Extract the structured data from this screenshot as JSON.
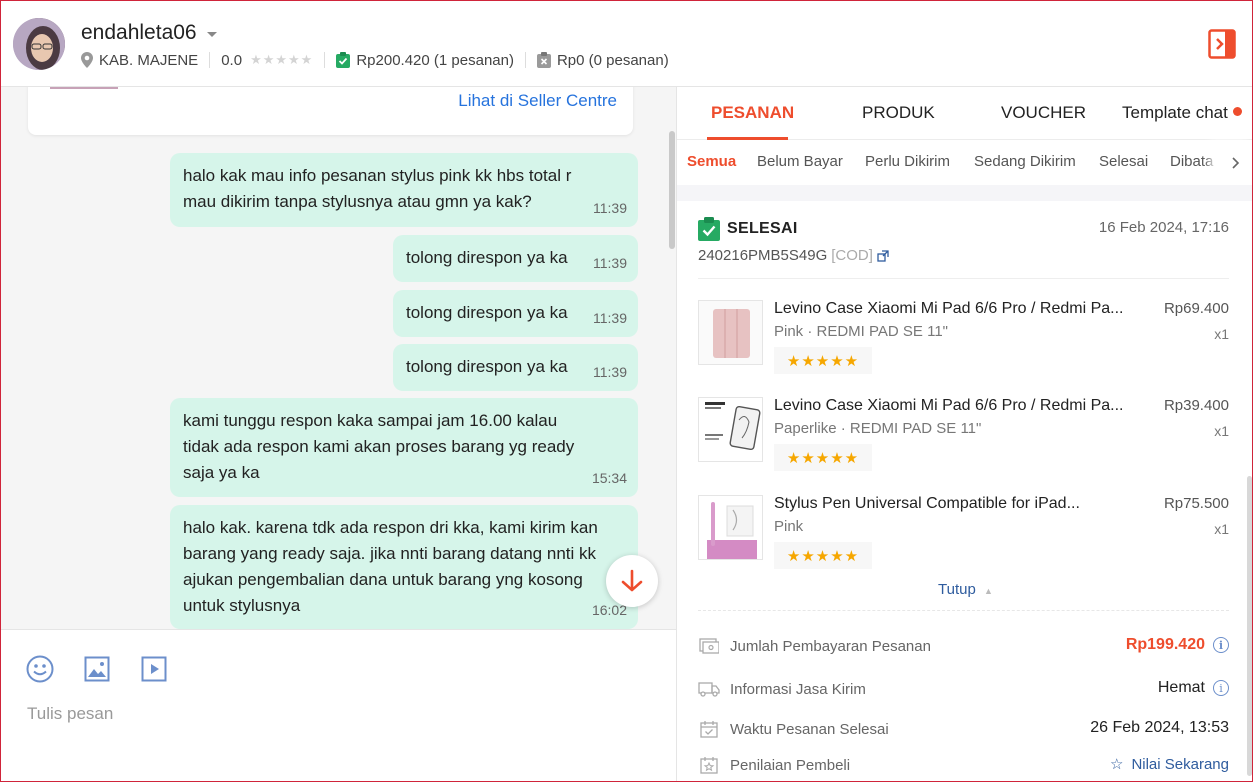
{
  "header": {
    "username": "endahleta06",
    "location": "KAB. MAJENE",
    "rating": "0.0",
    "orders_paid": "Rp200.420 (1 pesanan)",
    "orders_cancelled": "Rp0 (0 pesanan)"
  },
  "chat": {
    "seller_link": "Lihat di Seller Centre",
    "messages": [
      {
        "line1": "halo kak mau info pesanan  stylus pink kk hbs total r",
        "line2": "mau dikirim  tanpa stylusnya  atau gmn ya kak?",
        "time": "11:39"
      },
      {
        "line1": "tolong direspon ya ka",
        "time": "11:39"
      },
      {
        "line1": "tolong direspon ya ka",
        "time": "11:39"
      },
      {
        "line1": "tolong direspon ya ka",
        "time": "11:39"
      },
      {
        "line1": "kami tunggu respon kaka sampai jam  16.00 kalau",
        "line2": "tidak ada respon kami akan proses barang yg ready",
        "line3": "saja ya ka",
        "time": "15:34"
      },
      {
        "line1": "halo kak. karena tdk ada respon dri kka, kami kirim kan",
        "line2": "barang yang ready saja. jika nnti barang datang nnti kk",
        "line3": "ajukan pengembalian dana untuk barang yng kosong",
        "line4": "untuk stylusnya",
        "time": "16:02"
      }
    ],
    "composer_placeholder": "Tulis pesan"
  },
  "panel": {
    "tabs": [
      "PESANAN",
      "PRODUK",
      "VOUCHER",
      "Template chat"
    ],
    "subtabs": [
      "Semua",
      "Belum Bayar",
      "Perlu Dikirim",
      "Sedang Dikirim",
      "Selesai",
      "Dibata"
    ],
    "order": {
      "status": "SELESAI",
      "date": "16 Feb 2024, 17:16",
      "id": "240216PMB5S49G",
      "payment_tag": "[COD]",
      "items": [
        {
          "name": "Levino Case Xiaomi Mi Pad 6/6 Pro / Redmi Pa...",
          "variant": "Pink · REDMI PAD SE 11\"",
          "price": "Rp69.400",
          "qty": "x1",
          "stars": "★★★★★"
        },
        {
          "name": "Levino Case Xiaomi Mi Pad 6/6 Pro / Redmi Pa...",
          "variant": "Paperlike · REDMI PAD SE 11\"",
          "price": "Rp39.400",
          "qty": "x1",
          "stars": "★★★★★"
        },
        {
          "name": "Stylus Pen Universal Compatible for iPad...",
          "variant": "Pink",
          "price": "Rp75.500",
          "qty": "x1",
          "stars": "★★★★★"
        }
      ],
      "collapse_label": "Tutup",
      "details": {
        "payment_label": "Jumlah Pembayaran Pesanan",
        "payment_value": "Rp199.420",
        "shipping_label": "Informasi Jasa Kirim",
        "shipping_value": "Hemat",
        "completed_label": "Waktu Pesanan Selesai",
        "completed_value": "26 Feb 2024, 13:53",
        "review_label": "Penilaian Pembeli",
        "review_action": "Nilai Sekarang"
      }
    }
  },
  "colors": {
    "accent": "#ee4d2d",
    "bubble": "#d6f5ea",
    "link": "#2673dd",
    "star": "#f6a700"
  }
}
